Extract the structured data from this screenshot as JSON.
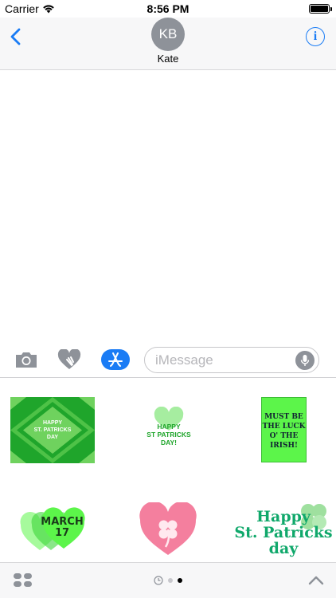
{
  "status_bar": {
    "carrier": "Carrier",
    "time": "8:56 PM",
    "battery_level": 1.0
  },
  "header": {
    "avatar_initials": "KB",
    "contact_name": "Kate",
    "info_label": "i"
  },
  "input_bar": {
    "placeholder": "iMessage",
    "value": ""
  },
  "stickers": {
    "sticker_1": {
      "line1": "HAPPY",
      "line2": "ST. PATRICKS",
      "line3": "DAY"
    },
    "sticker_2": {
      "line1": "HAPPY",
      "line2": "ST PATRICKS",
      "line3": "DAY!"
    },
    "sticker_3": {
      "line1": "MUST BE",
      "line2": "THE LUCK",
      "line3": "O' THE",
      "line4": "IRISH!"
    },
    "sticker_4": {
      "line1": "MARCH",
      "line2": "17"
    },
    "sticker_6": {
      "line1": "Happy",
      "line2": "St. Patricks",
      "line3": "day"
    }
  },
  "bottom_bar": {
    "page_count": 2,
    "active_page": 2
  },
  "colors": {
    "accent": "#1a7cf5",
    "green_dark": "#1fa52b",
    "green_light": "#5cf54a",
    "pink": "#f47f9e",
    "teal_green": "#10a86b"
  }
}
